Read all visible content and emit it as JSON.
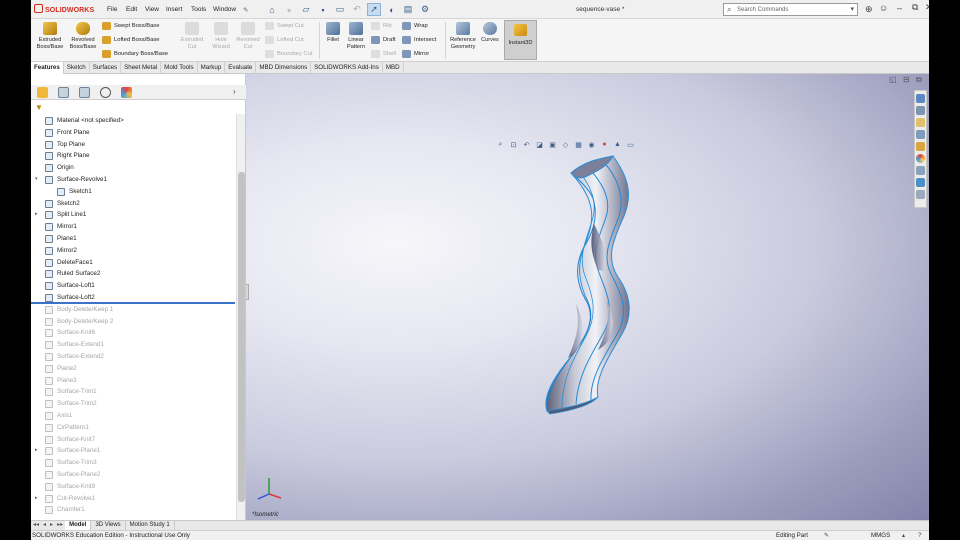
{
  "app": {
    "logo_text": "SOLIDWORKS",
    "document_title": "sequence-vase *",
    "menu": [
      "File",
      "Edit",
      "View",
      "Insert",
      "Tools",
      "Window"
    ],
    "search_placeholder": "Search Commands"
  },
  "ribbon": {
    "extruded_boss": [
      "Extruded",
      "Boss/Base"
    ],
    "revolved_boss": [
      "Revolved",
      "Boss/Base"
    ],
    "swept_boss": "Swept Boss/Base",
    "lofted_boss": "Lofted Boss/Base",
    "boundary_boss": "Boundary Boss/Base",
    "extruded_cut": [
      "Extruded",
      "Cut"
    ],
    "hole_wizard": [
      "Hole",
      "Wizard"
    ],
    "revolved_cut": [
      "Revolved",
      "Cut"
    ],
    "swept_cut": "Swept Cut",
    "lofted_cut": "Lofted Cut",
    "boundary_cut": "Boundary Cut",
    "fillet": "Fillet",
    "linear_pattern": [
      "Linear",
      "Pattern"
    ],
    "rib": "Rib",
    "draft": "Draft",
    "shell": "Shell",
    "wrap": "Wrap",
    "intersect": "Intersect",
    "mirror": "Mirror",
    "reference_geometry": [
      "Reference",
      "Geometry"
    ],
    "curves": "Curves",
    "instant3d": "Instant3D"
  },
  "tabs": [
    "Features",
    "Sketch",
    "Surfaces",
    "Sheet Metal",
    "Mold Tools",
    "Markup",
    "Evaluate",
    "MBD Dimensions",
    "SOLIDWORKS Add-Ins",
    "MBD"
  ],
  "tree": [
    {
      "label": "Material <not specified>",
      "indent": 0,
      "expand": "",
      "suppressed": false
    },
    {
      "label": "Front Plane",
      "indent": 0,
      "expand": "",
      "suppressed": false
    },
    {
      "label": "Top Plane",
      "indent": 0,
      "expand": "",
      "suppressed": false
    },
    {
      "label": "Right Plane",
      "indent": 0,
      "expand": "",
      "suppressed": false
    },
    {
      "label": "Origin",
      "indent": 0,
      "expand": "",
      "suppressed": false
    },
    {
      "label": "Surface-Revolve1",
      "indent": 0,
      "expand": "▾",
      "suppressed": false
    },
    {
      "label": "Sketch1",
      "indent": 1,
      "expand": "",
      "suppressed": false
    },
    {
      "label": "Sketch2",
      "indent": 0,
      "expand": "",
      "suppressed": false
    },
    {
      "label": "Split Line1",
      "indent": 0,
      "expand": "▸",
      "suppressed": false
    },
    {
      "label": "Mirror1",
      "indent": 0,
      "expand": "",
      "suppressed": false
    },
    {
      "label": "Plane1",
      "indent": 0,
      "expand": "",
      "suppressed": false
    },
    {
      "label": "Mirror2",
      "indent": 0,
      "expand": "",
      "suppressed": false
    },
    {
      "label": "DeleteFace1",
      "indent": 0,
      "expand": "",
      "suppressed": false
    },
    {
      "label": "Ruled Surface2",
      "indent": 0,
      "expand": "",
      "suppressed": false
    },
    {
      "label": "Surface-Loft1",
      "indent": 0,
      "expand": "",
      "suppressed": false
    },
    {
      "label": "Surface-Loft2",
      "indent": 0,
      "expand": "",
      "suppressed": false
    },
    {
      "label": "Body-Delete/Keep 1",
      "indent": 0,
      "expand": "",
      "suppressed": true
    },
    {
      "label": "Body-Delete/Keep 2",
      "indent": 0,
      "expand": "",
      "suppressed": true
    },
    {
      "label": "Surface-Knit6",
      "indent": 0,
      "expand": "",
      "suppressed": true
    },
    {
      "label": "Surface-Extend1",
      "indent": 0,
      "expand": "",
      "suppressed": true
    },
    {
      "label": "Surface-Extend2",
      "indent": 0,
      "expand": "",
      "suppressed": true
    },
    {
      "label": "Plane2",
      "indent": 0,
      "expand": "",
      "suppressed": true
    },
    {
      "label": "Plane3",
      "indent": 0,
      "expand": "",
      "suppressed": true
    },
    {
      "label": "Surface-Trim1",
      "indent": 0,
      "expand": "",
      "suppressed": true
    },
    {
      "label": "Surface-Trim2",
      "indent": 0,
      "expand": "",
      "suppressed": true
    },
    {
      "label": "Axis1",
      "indent": 0,
      "expand": "",
      "suppressed": true
    },
    {
      "label": "CirPattern1",
      "indent": 0,
      "expand": "",
      "suppressed": true
    },
    {
      "label": "Surface-Knit7",
      "indent": 0,
      "expand": "",
      "suppressed": true
    },
    {
      "label": "Surface-Plane1",
      "indent": 0,
      "expand": "▸",
      "suppressed": true
    },
    {
      "label": "Surface-Trim3",
      "indent": 0,
      "expand": "",
      "suppressed": true
    },
    {
      "label": "Surface-Plane2",
      "indent": 0,
      "expand": "",
      "suppressed": true
    },
    {
      "label": "Surface-Knit8",
      "indent": 0,
      "expand": "",
      "suppressed": true
    },
    {
      "label": "Cut-Revolve1",
      "indent": 0,
      "expand": "▸",
      "suppressed": true
    },
    {
      "label": "Chamfer1",
      "indent": 0,
      "expand": "",
      "suppressed": true
    }
  ],
  "viewport": {
    "view_label": "*Isometric"
  },
  "bottom_tabs": [
    "Model",
    "3D Views",
    "Motion Study 1"
  ],
  "status": {
    "edition": "SOLIDWORKS Education Edition - Instructional Use Only",
    "mode": "Editing Part",
    "units": "MMGS"
  },
  "colors": {
    "accent": "#3b73c9",
    "logo_red": "#d42a1e",
    "suppressed_text": "#a5a5a5",
    "viewport_bg_top": "#f6f6fa",
    "viewport_bg_bottom": "#8384aa"
  }
}
